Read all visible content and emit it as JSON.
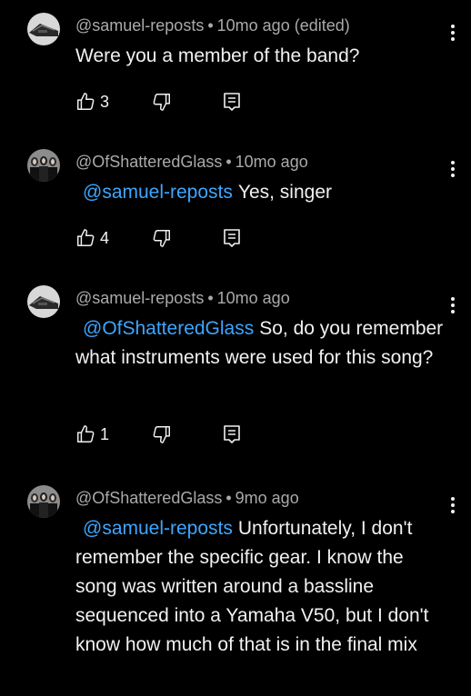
{
  "comments": [
    {
      "author": "@samuel-reposts",
      "separator": "•",
      "time": "10mo ago (edited)",
      "mention": "",
      "text": "Were you a member of the band?",
      "likes": "3",
      "avatar_icon": "avatar-samuel",
      "more_icon": "more-vert-icon"
    },
    {
      "author": "@OfShatteredGlass",
      "separator": "•",
      "time": "10mo ago",
      "mention": "@samuel-reposts",
      "text": "Yes, singer",
      "likes": "4",
      "avatar_icon": "avatar-band",
      "more_icon": "more-vert-icon"
    },
    {
      "author": "@samuel-reposts",
      "separator": "•",
      "time": "10mo ago",
      "mention": "@OfShatteredGlass",
      "text": "So, do you remember what instruments were used for this song?",
      "likes": "1",
      "avatar_icon": "avatar-samuel",
      "more_icon": "more-vert-icon"
    },
    {
      "author": "@OfShatteredGlass",
      "separator": "•",
      "time": "9mo ago",
      "mention": "@samuel-reposts",
      "text": "Unfortunately, I don't remember the specific gear. I know the song was written around a bassline sequenced into a Yamaha V50, but I don't know how much of that is in the final mix",
      "likes": "",
      "avatar_icon": "avatar-band",
      "more_icon": "more-vert-icon"
    }
  ],
  "icons": {
    "like": "thumbs-up-icon",
    "dislike": "thumbs-down-icon",
    "reply": "reply-comment-icon"
  },
  "colors": {
    "background": "#000000",
    "text": "#f1f1f1",
    "meta": "#aaaaaa",
    "mention": "#3ea6ff"
  }
}
